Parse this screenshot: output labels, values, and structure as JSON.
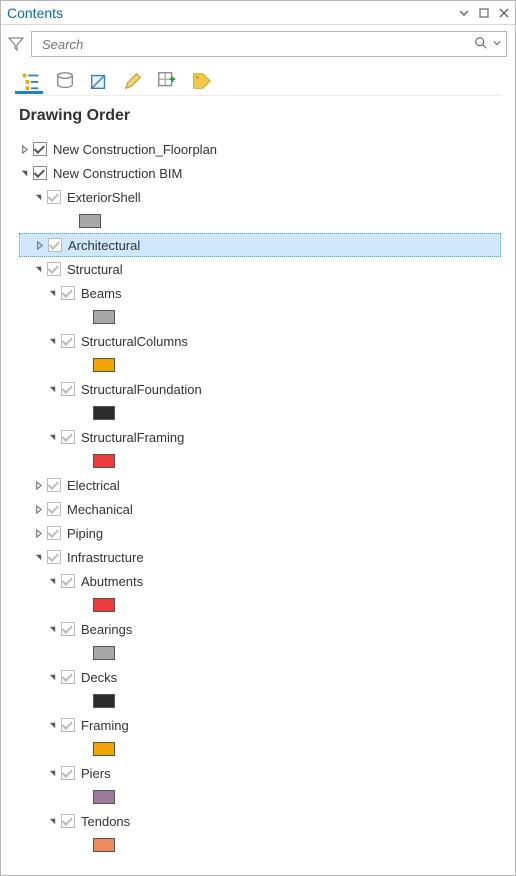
{
  "panel": {
    "title": "Contents"
  },
  "search": {
    "placeholder": "Search"
  },
  "heading": "Drawing Order",
  "tree": [
    {
      "id": "floorplan",
      "indent": 0,
      "expander": "collapsed",
      "checked": true,
      "dim": false,
      "label": "New Construction_Floorplan"
    },
    {
      "id": "bim",
      "indent": 0,
      "expander": "expanded",
      "checked": true,
      "dim": false,
      "label": "New Construction BIM"
    },
    {
      "id": "extsh",
      "indent": 1,
      "expander": "expanded",
      "checked": true,
      "dim": true,
      "label": "ExteriorShell"
    },
    {
      "id": "extsh-sw",
      "indent": 2,
      "swatch": "#a8a8a8"
    },
    {
      "id": "arch",
      "indent": 1,
      "expander": "collapsed",
      "checked": true,
      "dim": true,
      "label": "Architectural",
      "selected": true
    },
    {
      "id": "struct",
      "indent": 1,
      "expander": "expanded",
      "checked": true,
      "dim": true,
      "label": "Structural"
    },
    {
      "id": "beams",
      "indent": 2,
      "expander": "expanded",
      "checked": true,
      "dim": true,
      "label": "Beams"
    },
    {
      "id": "beams-sw",
      "indent": 3,
      "swatch": "#a8a8a8"
    },
    {
      "id": "cols",
      "indent": 2,
      "expander": "expanded",
      "checked": true,
      "dim": true,
      "label": "StructuralColumns"
    },
    {
      "id": "cols-sw",
      "indent": 3,
      "swatch": "#f4a300"
    },
    {
      "id": "found",
      "indent": 2,
      "expander": "expanded",
      "checked": true,
      "dim": true,
      "label": "StructuralFoundation"
    },
    {
      "id": "found-sw",
      "indent": 3,
      "swatch": "#2b2b2b"
    },
    {
      "id": "frame",
      "indent": 2,
      "expander": "expanded",
      "checked": true,
      "dim": true,
      "label": "StructuralFraming"
    },
    {
      "id": "frame-sw",
      "indent": 3,
      "swatch": "#ef3b3b"
    },
    {
      "id": "elec",
      "indent": 1,
      "expander": "collapsed",
      "checked": true,
      "dim": true,
      "label": "Electrical"
    },
    {
      "id": "mech",
      "indent": 1,
      "expander": "collapsed",
      "checked": true,
      "dim": true,
      "label": "Mechanical"
    },
    {
      "id": "pipe",
      "indent": 1,
      "expander": "collapsed",
      "checked": true,
      "dim": true,
      "label": "Piping"
    },
    {
      "id": "infra",
      "indent": 1,
      "expander": "expanded",
      "checked": true,
      "dim": true,
      "label": "Infrastructure"
    },
    {
      "id": "abut",
      "indent": 2,
      "expander": "expanded",
      "checked": true,
      "dim": true,
      "label": "Abutments"
    },
    {
      "id": "abut-sw",
      "indent": 3,
      "swatch": "#ef3b3b"
    },
    {
      "id": "bear",
      "indent": 2,
      "expander": "expanded",
      "checked": true,
      "dim": true,
      "label": "Bearings"
    },
    {
      "id": "bear-sw",
      "indent": 3,
      "swatch": "#a8a8a8"
    },
    {
      "id": "decks",
      "indent": 2,
      "expander": "expanded",
      "checked": true,
      "dim": true,
      "label": "Decks"
    },
    {
      "id": "decks-sw",
      "indent": 3,
      "swatch": "#2b2b2b"
    },
    {
      "id": "fram2",
      "indent": 2,
      "expander": "expanded",
      "checked": true,
      "dim": true,
      "label": "Framing"
    },
    {
      "id": "fram2-sw",
      "indent": 3,
      "swatch": "#f4a300"
    },
    {
      "id": "piers",
      "indent": 2,
      "expander": "expanded",
      "checked": true,
      "dim": true,
      "label": "Piers"
    },
    {
      "id": "piers-sw",
      "indent": 3,
      "swatch": "#9b7b9b"
    },
    {
      "id": "tend",
      "indent": 2,
      "expander": "expanded",
      "checked": true,
      "dim": true,
      "label": "Tendons"
    },
    {
      "id": "tend-sw",
      "indent": 3,
      "swatch": "#ef8a5a"
    }
  ]
}
